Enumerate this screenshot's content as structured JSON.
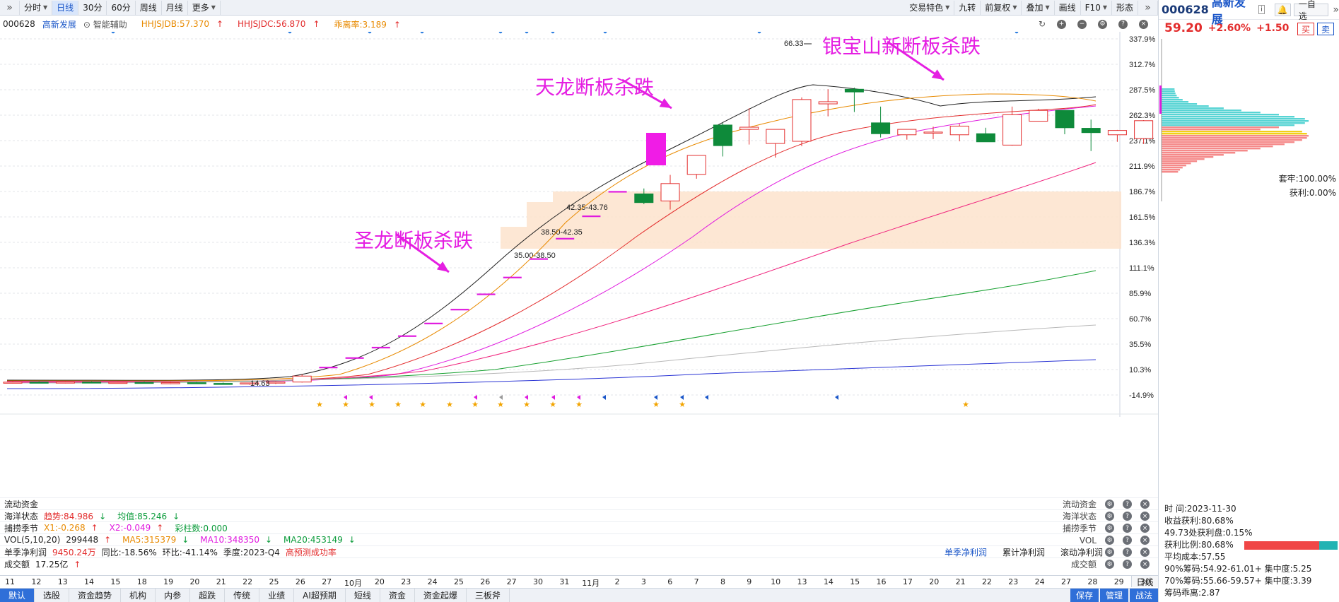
{
  "toolbar": {
    "expand_icon": "double-chevron-right-icon",
    "timeframes": [
      "分时",
      "日线",
      "30分",
      "60分",
      "周线",
      "月线",
      "更多"
    ],
    "active_timeframe": "日线",
    "right_items": [
      "交易特色",
      "九转",
      "前复权",
      "叠加",
      "画线",
      "F10",
      "形态"
    ]
  },
  "info": {
    "code": "000628",
    "name": "高新发展",
    "assist": "智能辅助",
    "ind1": "HHJSJDB:57.370",
    "ind2": "HHJSJDC:56.870",
    "ind3": "乖离率:3.189"
  },
  "annotations": [
    {
      "text": "天龙断板杀跌"
    },
    {
      "text": "银宝山新断板杀跌"
    },
    {
      "text": "圣龙断板杀跌"
    }
  ],
  "price_labels": {
    "high": "66.33",
    "low": "14.63"
  },
  "zones": [
    "42.35-43.76",
    "38.50-42.35",
    "35.00-38.50"
  ],
  "chart_data": {
    "type": "candlestick",
    "y_axis_ticks": [
      "337.9%",
      "312.7%",
      "287.5%",
      "262.3%",
      "237.1%",
      "211.9%",
      "186.7%",
      "161.5%",
      "136.3%",
      "111.1%",
      "85.9%",
      "60.7%",
      "35.5%",
      "10.3%",
      "-14.9%"
    ],
    "x_axis_labels": [
      "11",
      "12",
      "13",
      "14",
      "15",
      "18",
      "19",
      "20",
      "21",
      "22",
      "25",
      "26",
      "27",
      "10月",
      "20",
      "23",
      "24",
      "25",
      "26",
      "27",
      "30",
      "31",
      "11月",
      "2",
      "3",
      "6",
      "7",
      "8",
      "9",
      "10",
      "13",
      "14",
      "15",
      "16",
      "17",
      "20",
      "21",
      "22",
      "23",
      "24",
      "27",
      "28",
      "29",
      "30"
    ],
    "price_range": [
      11.7,
      69.1
    ],
    "candles": [
      {
        "o": 14.73,
        "h": 14.95,
        "l": 14.55,
        "c": 14.78
      },
      {
        "o": 14.78,
        "h": 14.95,
        "l": 14.6,
        "c": 14.7
      },
      {
        "o": 14.7,
        "h": 14.9,
        "l": 14.55,
        "c": 14.8
      },
      {
        "o": 14.8,
        "h": 14.95,
        "l": 14.6,
        "c": 14.66
      },
      {
        "o": 14.66,
        "h": 14.85,
        "l": 14.5,
        "c": 14.74
      },
      {
        "o": 14.74,
        "h": 14.9,
        "l": 14.55,
        "c": 14.6
      },
      {
        "o": 14.6,
        "h": 14.8,
        "l": 14.4,
        "c": 14.68
      },
      {
        "o": 14.68,
        "h": 14.82,
        "l": 14.45,
        "c": 14.55
      },
      {
        "o": 14.55,
        "h": 14.7,
        "l": 14.35,
        "c": 14.5
      },
      {
        "o": 14.5,
        "h": 14.7,
        "l": 14.3,
        "c": 14.63
      },
      {
        "o": 14.63,
        "h": 14.9,
        "l": 14.45,
        "c": 14.8
      },
      {
        "o": 14.8,
        "h": 16.2,
        "l": 14.7,
        "c": 15.9
      },
      {
        "o": 17.49,
        "h": 17.49,
        "l": 17.49,
        "c": 17.49
      },
      {
        "o": 19.24,
        "h": 19.24,
        "l": 19.24,
        "c": 19.24
      },
      {
        "o": 21.16,
        "h": 21.16,
        "l": 21.16,
        "c": 21.16
      },
      {
        "o": 23.28,
        "h": 23.28,
        "l": 23.28,
        "c": 23.28
      },
      {
        "o": 25.61,
        "h": 25.61,
        "l": 25.61,
        "c": 25.61
      },
      {
        "o": 28.17,
        "h": 28.17,
        "l": 28.17,
        "c": 28.17
      },
      {
        "o": 30.99,
        "h": 30.99,
        "l": 30.99,
        "c": 30.99
      },
      {
        "o": 34.09,
        "h": 34.09,
        "l": 34.09,
        "c": 34.09
      },
      {
        "o": 37.5,
        "h": 37.5,
        "l": 37.5,
        "c": 37.5
      },
      {
        "o": 41.25,
        "h": 41.25,
        "l": 41.25,
        "c": 41.25
      },
      {
        "o": 45.38,
        "h": 45.38,
        "l": 45.38,
        "c": 45.38
      },
      {
        "o": 49.9,
        "h": 49.9,
        "l": 49.9,
        "c": 49.9
      },
      {
        "o": 49.5,
        "h": 50.5,
        "l": 47.6,
        "c": 47.9
      },
      {
        "o": 48.2,
        "h": 53.0,
        "l": 46.6,
        "c": 51.4
      },
      {
        "o": 53.1,
        "h": 56.6,
        "l": 52.3,
        "c": 56.6
      },
      {
        "o": 62.2,
        "h": 62.6,
        "l": 56.4,
        "c": 58.4
      },
      {
        "o": 61.4,
        "h": 65.3,
        "l": 58.6,
        "c": 61.8
      },
      {
        "o": 58.8,
        "h": 61.4,
        "l": 56.2,
        "c": 61.4
      },
      {
        "o": 59.2,
        "h": 67.3,
        "l": 58.3,
        "c": 66.9
      },
      {
        "o": 66.1,
        "h": 68.8,
        "l": 63.8,
        "c": 66.5
      },
      {
        "o": 68.8,
        "h": 69.1,
        "l": 64.6,
        "c": 68.3
      },
      {
        "o": 62.6,
        "h": 65.6,
        "l": 59.9,
        "c": 60.6
      },
      {
        "o": 60.4,
        "h": 61.4,
        "l": 59.5,
        "c": 61.4
      },
      {
        "o": 60.8,
        "h": 61.9,
        "l": 59.6,
        "c": 60.9
      },
      {
        "o": 60.4,
        "h": 62.4,
        "l": 59.2,
        "c": 62.0
      },
      {
        "o": 60.6,
        "h": 61.7,
        "l": 59.2,
        "c": 59.1
      },
      {
        "o": 58.5,
        "h": 65.6,
        "l": 58.4,
        "c": 64.1
      },
      {
        "o": 62.9,
        "h": 65.2,
        "l": 62.9,
        "c": 64.9
      },
      {
        "o": 64.9,
        "h": 64.9,
        "l": 60.5,
        "c": 61.7
      },
      {
        "o": 61.6,
        "h": 63.2,
        "l": 57.4,
        "c": 60.8
      },
      {
        "o": 60.4,
        "h": 61.3,
        "l": 59.1,
        "c": 61.2
      },
      {
        "o": 59.7,
        "h": 63.1,
        "l": 58.7,
        "c": 63.0
      }
    ]
  },
  "indicators": {
    "flow": "流动资金",
    "hy": {
      "label": "海洋状态",
      "a": "趋势:84.986",
      "b": "均值:85.246"
    },
    "bl": {
      "label": "捕捞季节",
      "a": "X1:-0.268",
      "b": "X2:-0.049",
      "c": "彩柱数:0.000"
    },
    "vol": {
      "label": "VOL(5,10,20)",
      "v": "299448",
      "ma5": "MA5:315379",
      "ma10": "MA10:348350",
      "ma20": "MA20:453149"
    },
    "profit": {
      "label": "单季净利润",
      "v": "9450.24万",
      "yoy": "同比:-18.56%",
      "qoq": "环比:-41.14%",
      "q": "季度:2023-Q4",
      "pred": "高预测成功率",
      "links": [
        "单季净利润",
        "累计净利润",
        "滚动净利润"
      ]
    },
    "amount": {
      "label": "成交额",
      "v": "17.25亿"
    },
    "right_labels": [
      "流动资金",
      "海洋状态",
      "捕捞季节",
      "VOL",
      "",
      "成交额"
    ]
  },
  "daily_label": "日线",
  "bottom_tabs": [
    "默认",
    "选股",
    "资金趋势",
    "机构",
    "内参",
    "超跌",
    "传统",
    "业绩",
    "AI超预期",
    "短线",
    "资金",
    "资金起爆",
    "三板斧"
  ],
  "bottom_right": [
    "保存",
    "管理",
    "战法"
  ],
  "right_panel": {
    "code": "000628",
    "name": "高新发展",
    "self_select": "一自选",
    "price": "59.20",
    "change": "+2.60%",
    "change_abs": "+1.50",
    "buy": "买",
    "sell": "卖",
    "trapped": "套牢:100.00%",
    "profit_ratio": "获利:0.00%",
    "time_label": "时       间:2023-11-30",
    "rows": [
      "收益获利:80.68%",
      "49.73处获利盘:0.15%",
      "获利比例:80.68%",
      "平均成本:57.55",
      "90%筹码:54.92-61.01+ 集中度:5.25",
      "70%筹码:55.66-59.57+ 集中度:3.39",
      "筹码乖离:2.87"
    ],
    "ratio_value": 80.68
  },
  "colors": {
    "up": "#e32d2d",
    "down": "#0e8a3a",
    "zone": "#fde3cc",
    "annotation": "#e51fe2"
  }
}
